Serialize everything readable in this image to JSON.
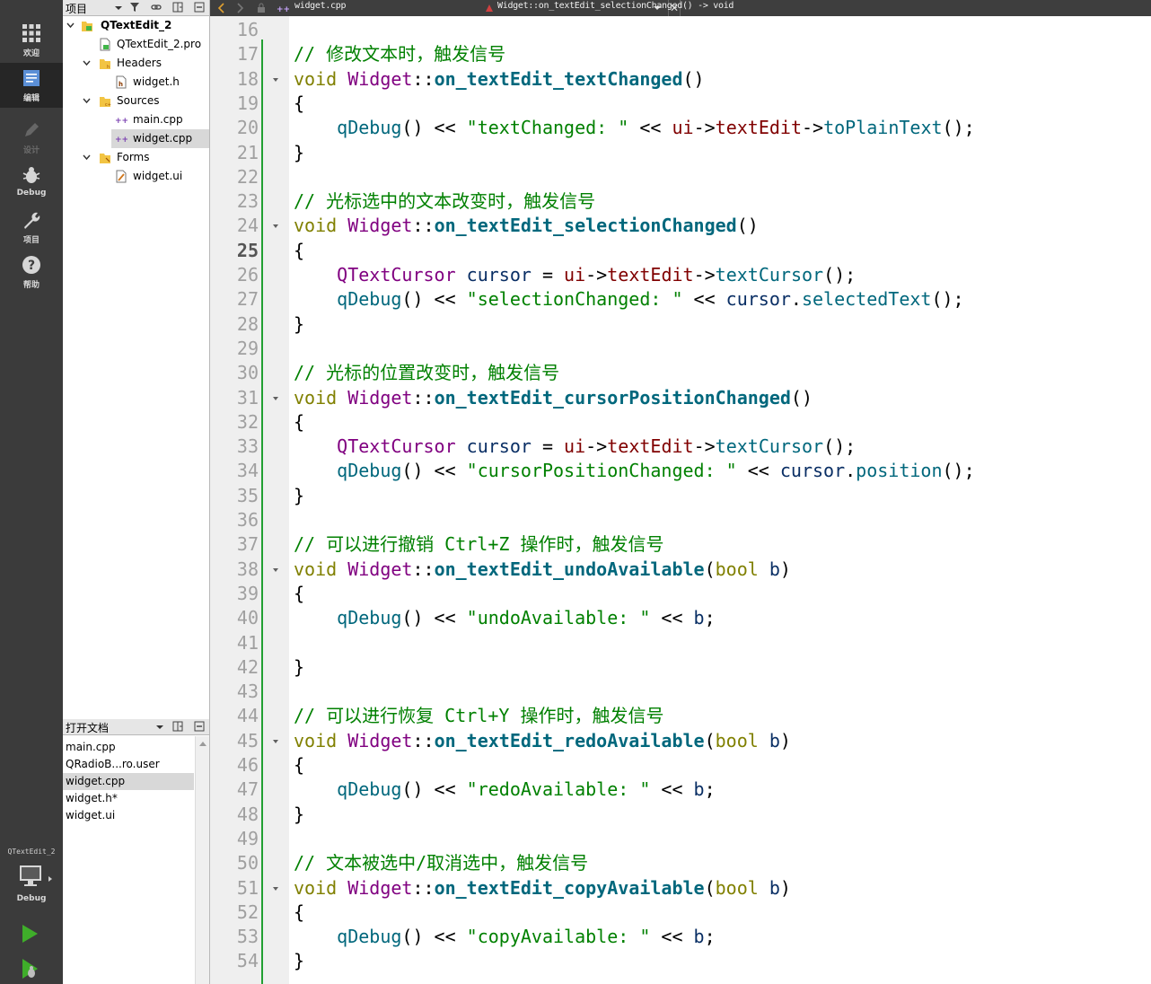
{
  "modebar": {
    "items": [
      {
        "label": "欢迎",
        "icon": "grid-icon"
      },
      {
        "label": "编辑",
        "icon": "edit-doc-icon"
      },
      {
        "label": "设计",
        "icon": "pen-icon"
      },
      {
        "label": "Debug",
        "icon": "bug-icon"
      },
      {
        "label": "项目",
        "icon": "wrench-icon"
      },
      {
        "label": "帮助",
        "icon": "help-icon"
      }
    ],
    "kit_name": "QTextEdit_2",
    "kit_mode": "Debug"
  },
  "project_panel": {
    "title": "项目",
    "tree": [
      {
        "label": "QTextEdit_2",
        "icon": "qt-project-icon"
      },
      {
        "label": "QTextEdit_2.pro",
        "icon": "pro-file-icon"
      },
      {
        "label": "Headers",
        "icon": "folder-icon"
      },
      {
        "label": "widget.h",
        "icon": "header-file-icon"
      },
      {
        "label": "Sources",
        "icon": "folder-icon"
      },
      {
        "label": "main.cpp",
        "icon": "cpp-file-icon"
      },
      {
        "label": "widget.cpp",
        "icon": "cpp-file-icon"
      },
      {
        "label": "Forms",
        "icon": "folder-icon"
      },
      {
        "label": "widget.ui",
        "icon": "ui-file-icon"
      }
    ]
  },
  "open_documents": {
    "title": "打开文档",
    "items": [
      "main.cpp",
      "QRadioB...ro.user",
      "widget.cpp",
      "widget.h*",
      "widget.ui"
    ]
  },
  "editor_toolbar": {
    "file_name": "widget.cpp",
    "symbol": "Widget::on_textEdit_selectionChanged() -> void"
  },
  "editor": {
    "current_line": 25,
    "lines": [
      {
        "n": "16",
        "fold": false,
        "t": [
          [
            "plain",
            ""
          ]
        ]
      },
      {
        "n": "17",
        "fold": false,
        "t": [
          [
            "cmt",
            "// 修改文本时，触发信号"
          ]
        ]
      },
      {
        "n": "18",
        "fold": true,
        "t": [
          [
            "kw",
            "void"
          ],
          [
            "plain",
            " "
          ],
          [
            "cls",
            "Widget"
          ],
          [
            "plain",
            "::"
          ],
          [
            "fn",
            "on_textEdit_textChanged"
          ],
          [
            "plain",
            "()"
          ]
        ]
      },
      {
        "n": "19",
        "fold": false,
        "t": [
          [
            "plain",
            "{"
          ]
        ]
      },
      {
        "n": "20",
        "fold": false,
        "t": [
          [
            "plain",
            "    "
          ],
          [
            "call",
            "qDebug"
          ],
          [
            "plain",
            "() << "
          ],
          [
            "str",
            "\"textChanged: \""
          ],
          [
            "plain",
            " << "
          ],
          [
            "mem",
            "ui"
          ],
          [
            "plain",
            "->"
          ],
          [
            "mem",
            "textEdit"
          ],
          [
            "plain",
            "->"
          ],
          [
            "call",
            "toPlainText"
          ],
          [
            "plain",
            "();"
          ]
        ]
      },
      {
        "n": "21",
        "fold": false,
        "t": [
          [
            "plain",
            "}"
          ]
        ]
      },
      {
        "n": "22",
        "fold": false,
        "t": [
          [
            "plain",
            ""
          ]
        ]
      },
      {
        "n": "23",
        "fold": false,
        "t": [
          [
            "cmt",
            "// 光标选中的文本改变时，触发信号"
          ]
        ]
      },
      {
        "n": "24",
        "fold": true,
        "t": [
          [
            "kw",
            "void"
          ],
          [
            "plain",
            " "
          ],
          [
            "cls",
            "Widget"
          ],
          [
            "plain",
            "::"
          ],
          [
            "fn",
            "on_textEdit_selectionChanged"
          ],
          [
            "plain",
            "()"
          ]
        ]
      },
      {
        "n": "25",
        "fold": false,
        "t": [
          [
            "plain",
            "{"
          ]
        ]
      },
      {
        "n": "26",
        "fold": false,
        "t": [
          [
            "plain",
            "    "
          ],
          [
            "cls",
            "QTextCursor"
          ],
          [
            "plain",
            " "
          ],
          [
            "var",
            "cursor"
          ],
          [
            "plain",
            " = "
          ],
          [
            "mem",
            "ui"
          ],
          [
            "plain",
            "->"
          ],
          [
            "mem",
            "textEdit"
          ],
          [
            "plain",
            "->"
          ],
          [
            "call",
            "textCursor"
          ],
          [
            "plain",
            "();"
          ]
        ]
      },
      {
        "n": "27",
        "fold": false,
        "t": [
          [
            "plain",
            "    "
          ],
          [
            "call",
            "qDebug"
          ],
          [
            "plain",
            "() << "
          ],
          [
            "str",
            "\"selectionChanged: \""
          ],
          [
            "plain",
            " << "
          ],
          [
            "var",
            "cursor"
          ],
          [
            "plain",
            "."
          ],
          [
            "call",
            "selectedText"
          ],
          [
            "plain",
            "();"
          ]
        ]
      },
      {
        "n": "28",
        "fold": false,
        "t": [
          [
            "plain",
            "}"
          ]
        ]
      },
      {
        "n": "29",
        "fold": false,
        "t": [
          [
            "plain",
            ""
          ]
        ]
      },
      {
        "n": "30",
        "fold": false,
        "t": [
          [
            "cmt",
            "// 光标的位置改变时，触发信号"
          ]
        ]
      },
      {
        "n": "31",
        "fold": true,
        "t": [
          [
            "kw",
            "void"
          ],
          [
            "plain",
            " "
          ],
          [
            "cls",
            "Widget"
          ],
          [
            "plain",
            "::"
          ],
          [
            "fn",
            "on_textEdit_cursorPositionChanged"
          ],
          [
            "plain",
            "()"
          ]
        ]
      },
      {
        "n": "32",
        "fold": false,
        "t": [
          [
            "plain",
            "{"
          ]
        ]
      },
      {
        "n": "33",
        "fold": false,
        "t": [
          [
            "plain",
            "    "
          ],
          [
            "cls",
            "QTextCursor"
          ],
          [
            "plain",
            " "
          ],
          [
            "var",
            "cursor"
          ],
          [
            "plain",
            " = "
          ],
          [
            "mem",
            "ui"
          ],
          [
            "plain",
            "->"
          ],
          [
            "mem",
            "textEdit"
          ],
          [
            "plain",
            "->"
          ],
          [
            "call",
            "textCursor"
          ],
          [
            "plain",
            "();"
          ]
        ]
      },
      {
        "n": "34",
        "fold": false,
        "t": [
          [
            "plain",
            "    "
          ],
          [
            "call",
            "qDebug"
          ],
          [
            "plain",
            "() << "
          ],
          [
            "str",
            "\"cursorPositionChanged: \""
          ],
          [
            "plain",
            " << "
          ],
          [
            "var",
            "cursor"
          ],
          [
            "plain",
            "."
          ],
          [
            "call",
            "position"
          ],
          [
            "plain",
            "();"
          ]
        ]
      },
      {
        "n": "35",
        "fold": false,
        "t": [
          [
            "plain",
            "}"
          ]
        ]
      },
      {
        "n": "36",
        "fold": false,
        "t": [
          [
            "plain",
            ""
          ]
        ]
      },
      {
        "n": "37",
        "fold": false,
        "t": [
          [
            "cmt",
            "// 可以进行撤销 Ctrl+Z 操作时，触发信号"
          ]
        ]
      },
      {
        "n": "38",
        "fold": true,
        "t": [
          [
            "kw",
            "void"
          ],
          [
            "plain",
            " "
          ],
          [
            "cls",
            "Widget"
          ],
          [
            "plain",
            "::"
          ],
          [
            "fn",
            "on_textEdit_undoAvailable"
          ],
          [
            "plain",
            "("
          ],
          [
            "kw",
            "bool"
          ],
          [
            "plain",
            " "
          ],
          [
            "var",
            "b"
          ],
          [
            "plain",
            ")"
          ]
        ]
      },
      {
        "n": "39",
        "fold": false,
        "t": [
          [
            "plain",
            "{"
          ]
        ]
      },
      {
        "n": "40",
        "fold": false,
        "t": [
          [
            "plain",
            "    "
          ],
          [
            "call",
            "qDebug"
          ],
          [
            "plain",
            "() << "
          ],
          [
            "str",
            "\"undoAvailable: \""
          ],
          [
            "plain",
            " << "
          ],
          [
            "var",
            "b"
          ],
          [
            "plain",
            ";"
          ]
        ]
      },
      {
        "n": "41",
        "fold": false,
        "t": [
          [
            "plain",
            ""
          ]
        ]
      },
      {
        "n": "42",
        "fold": false,
        "t": [
          [
            "plain",
            "}"
          ]
        ]
      },
      {
        "n": "43",
        "fold": false,
        "t": [
          [
            "plain",
            ""
          ]
        ]
      },
      {
        "n": "44",
        "fold": false,
        "t": [
          [
            "cmt",
            "// 可以进行恢复 Ctrl+Y 操作时，触发信号"
          ]
        ]
      },
      {
        "n": "45",
        "fold": true,
        "t": [
          [
            "kw",
            "void"
          ],
          [
            "plain",
            " "
          ],
          [
            "cls",
            "Widget"
          ],
          [
            "plain",
            "::"
          ],
          [
            "fn",
            "on_textEdit_redoAvailable"
          ],
          [
            "plain",
            "("
          ],
          [
            "kw",
            "bool"
          ],
          [
            "plain",
            " "
          ],
          [
            "var",
            "b"
          ],
          [
            "plain",
            ")"
          ]
        ]
      },
      {
        "n": "46",
        "fold": false,
        "t": [
          [
            "plain",
            "{"
          ]
        ]
      },
      {
        "n": "47",
        "fold": false,
        "t": [
          [
            "plain",
            "    "
          ],
          [
            "call",
            "qDebug"
          ],
          [
            "plain",
            "() << "
          ],
          [
            "str",
            "\"redoAvailable: \""
          ],
          [
            "plain",
            " << "
          ],
          [
            "var",
            "b"
          ],
          [
            "plain",
            ";"
          ]
        ]
      },
      {
        "n": "48",
        "fold": false,
        "t": [
          [
            "plain",
            "}"
          ]
        ]
      },
      {
        "n": "49",
        "fold": false,
        "t": [
          [
            "plain",
            ""
          ]
        ]
      },
      {
        "n": "50",
        "fold": false,
        "t": [
          [
            "cmt",
            "// 文本被选中/取消选中，触发信号"
          ]
        ]
      },
      {
        "n": "51",
        "fold": true,
        "t": [
          [
            "kw",
            "void"
          ],
          [
            "plain",
            " "
          ],
          [
            "cls",
            "Widget"
          ],
          [
            "plain",
            "::"
          ],
          [
            "fn",
            "on_textEdit_copyAvailable"
          ],
          [
            "plain",
            "("
          ],
          [
            "kw",
            "bool"
          ],
          [
            "plain",
            " "
          ],
          [
            "var",
            "b"
          ],
          [
            "plain",
            ")"
          ]
        ]
      },
      {
        "n": "52",
        "fold": false,
        "t": [
          [
            "plain",
            "{"
          ]
        ]
      },
      {
        "n": "53",
        "fold": false,
        "t": [
          [
            "plain",
            "    "
          ],
          [
            "call",
            "qDebug"
          ],
          [
            "plain",
            "() << "
          ],
          [
            "str",
            "\"copyAvailable: \""
          ],
          [
            "plain",
            " << "
          ],
          [
            "var",
            "b"
          ],
          [
            "plain",
            ";"
          ]
        ]
      },
      {
        "n": "54",
        "fold": false,
        "t": [
          [
            "plain",
            "}"
          ]
        ]
      }
    ]
  },
  "colors": {
    "keyword": "#808000",
    "class": "#800080",
    "function_decl": "#00677c",
    "string": "#008000",
    "comment": "#008000",
    "member": "#800000",
    "variable": "#092e64",
    "modebar_bg": "#3b3b3b",
    "changed_marker": "#22a032"
  }
}
